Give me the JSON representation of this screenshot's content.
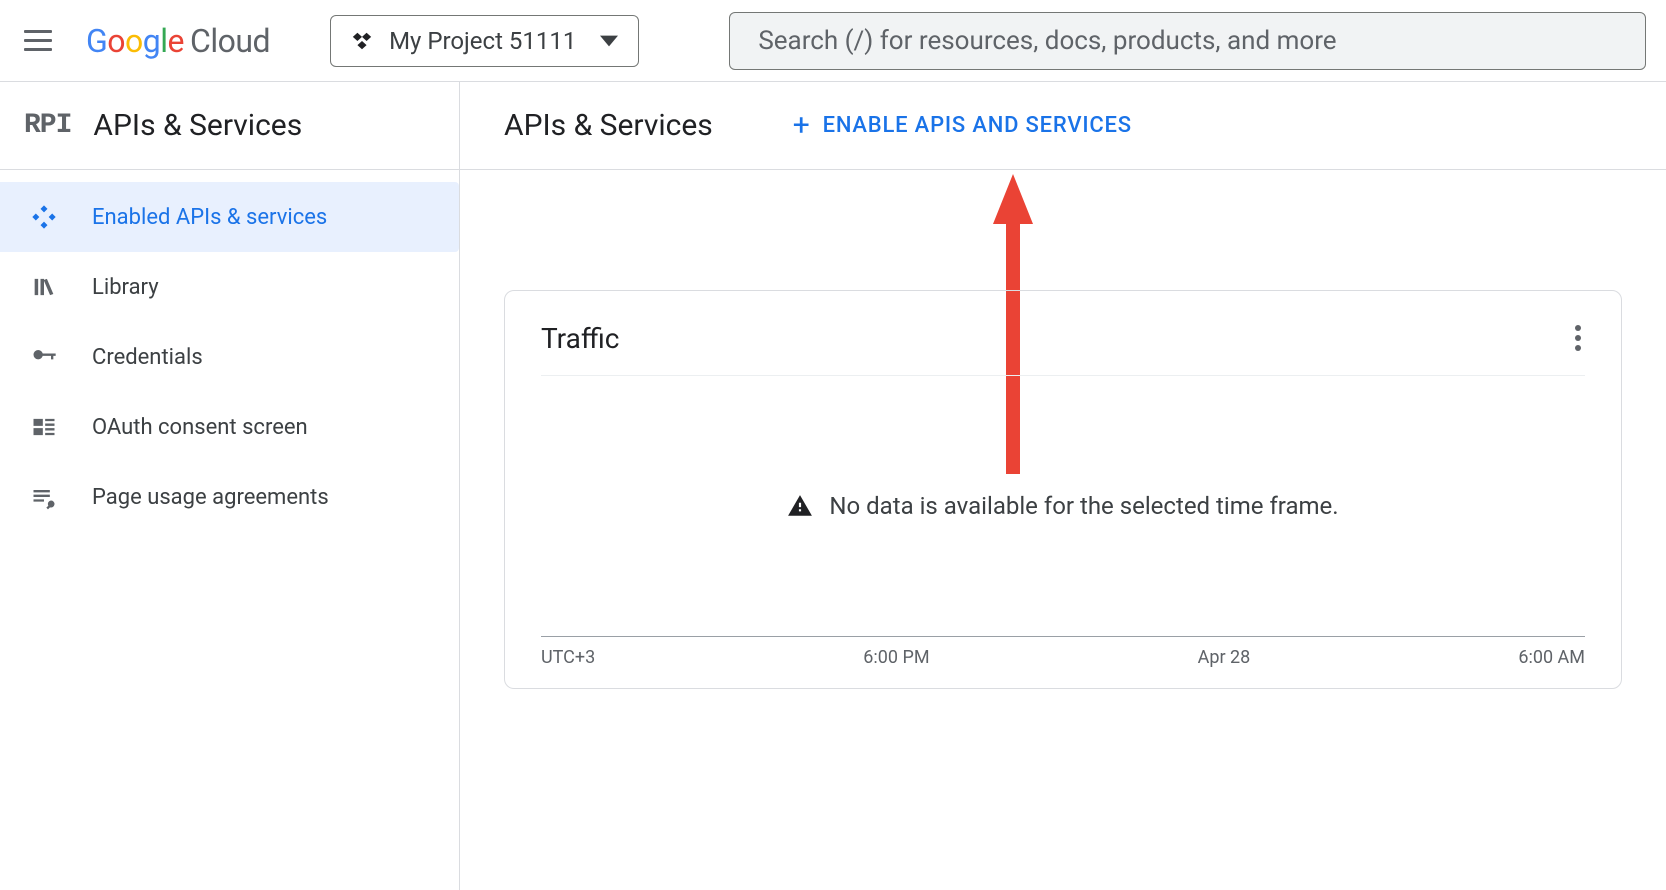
{
  "header": {
    "logo_text": "Google",
    "logo_product": "Cloud",
    "project_name": "My Project 51111",
    "search_placeholder": "Search (/) for resources, docs, products, and more"
  },
  "sidebar": {
    "title": "APIs & Services",
    "items": [
      {
        "label": "Enabled APIs & services",
        "active": true,
        "icon": "diamond"
      },
      {
        "label": "Library",
        "active": false,
        "icon": "library"
      },
      {
        "label": "Credentials",
        "active": false,
        "icon": "key"
      },
      {
        "label": "OAuth consent screen",
        "active": false,
        "icon": "consent"
      },
      {
        "label": "Page usage agreements",
        "active": false,
        "icon": "agreements"
      }
    ]
  },
  "main": {
    "title": "APIs & Services",
    "enable_label": "ENABLE APIS AND SERVICES"
  },
  "traffic_card": {
    "title": "Traffic",
    "empty_message": "No data is available for the selected time frame.",
    "axis_ticks": [
      "UTC+3",
      "6:00 PM",
      "Apr 28",
      "6:00 AM"
    ]
  },
  "annotation": {
    "arrow_color": "#ea4335"
  }
}
